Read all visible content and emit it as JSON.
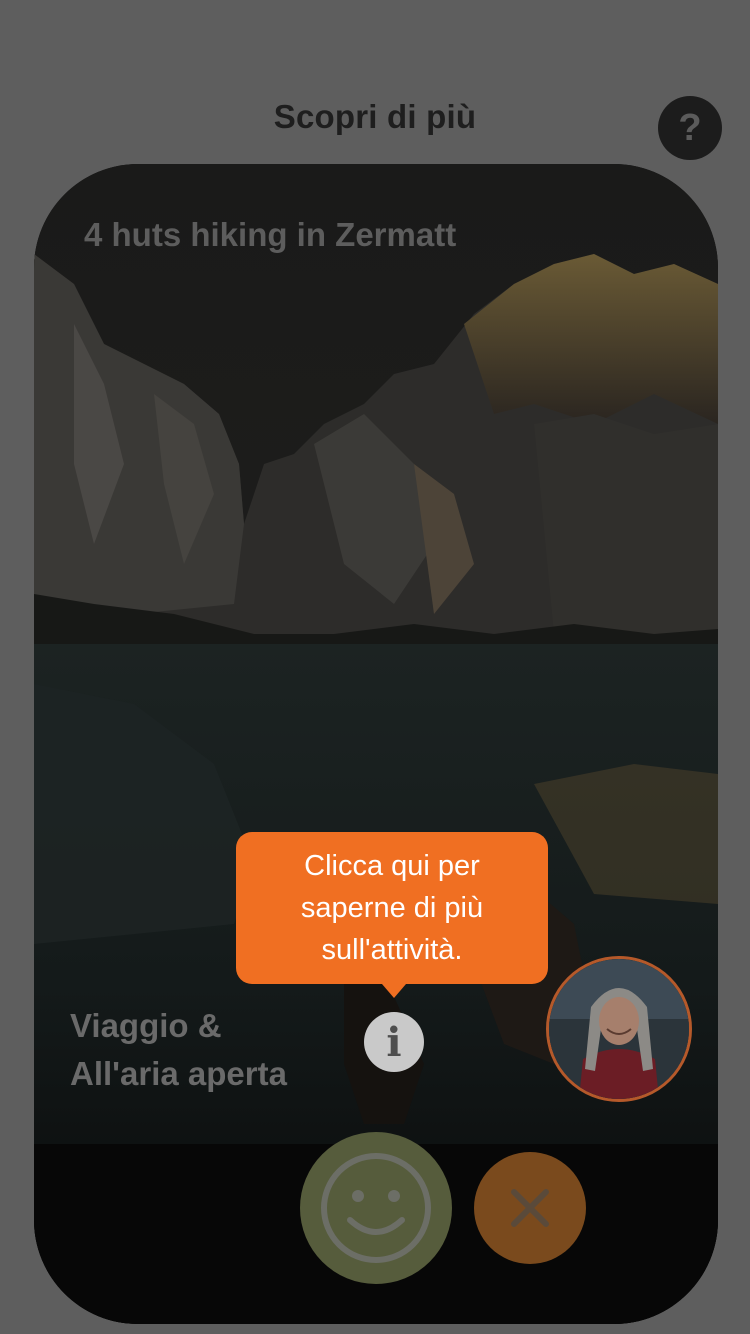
{
  "header": {
    "title": "Scopri di più",
    "help_icon": "question-mark-icon",
    "help_label": "?"
  },
  "card": {
    "title": "4 huts hiking in Zermatt",
    "category_lines": [
      "Viaggio &",
      "All'aria aperta"
    ],
    "image": "mountain-lake-photo"
  },
  "tooltip": {
    "lines": [
      "Clicca qui per",
      "saperne di più",
      "sull'attività."
    ]
  },
  "info_button": {
    "icon": "info-icon",
    "label": "i"
  },
  "avatar": {
    "image": "host-avatar"
  },
  "actions": {
    "like_icon": "smiley-icon",
    "dismiss_icon": "close-icon"
  },
  "colors": {
    "overlay": "#5e5e5e",
    "accent": "#f06f22",
    "like": "#565c3c",
    "dismiss": "#7a4a1d"
  }
}
